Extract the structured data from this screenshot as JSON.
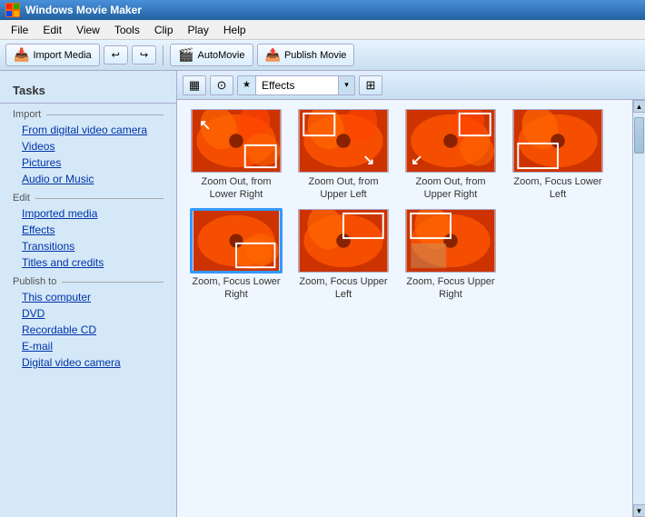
{
  "titlebar": {
    "app_name": "Windows Movie Maker",
    "icon_text": "M"
  },
  "menubar": {
    "items": [
      "File",
      "Edit",
      "View",
      "Tools",
      "Clip",
      "Play",
      "Help"
    ]
  },
  "toolbar": {
    "import_label": "Import Media",
    "automovie_label": "AutoMovie",
    "publish_label": "Publish Movie"
  },
  "sidebar": {
    "tasks_label": "Tasks",
    "import_section": "Import",
    "import_links": [
      "From digital video camera",
      "Videos",
      "Pictures",
      "Audio or Music"
    ],
    "edit_section": "Edit",
    "edit_links": [
      "Imported media",
      "Effects",
      "Transitions",
      "Titles and credits"
    ],
    "publish_section": "Publish to",
    "publish_links": [
      "This computer",
      "DVD",
      "Recordable CD",
      "E-mail",
      "Digital video camera"
    ]
  },
  "content_toolbar": {
    "view1_icon": "▦",
    "view2_icon": "●",
    "dropdown_label": "Effects",
    "dropdown_icon": "★",
    "extra_icon": "⊞"
  },
  "effects": [
    {
      "id": "e1",
      "label": "Zoom Out, from Lower Right",
      "selected": false,
      "arrow_pos": "top-left",
      "box_pos": "bottom-right"
    },
    {
      "id": "e2",
      "label": "Zoom Out, from Upper Left",
      "selected": false,
      "arrow_pos": "bottom-right",
      "box_pos": "top-left"
    },
    {
      "id": "e3",
      "label": "Zoom Out, from Upper Right",
      "selected": false,
      "arrow_pos": "bottom-left",
      "box_pos": "top-right"
    },
    {
      "id": "e4",
      "label": "Zoom, Focus Lower Left",
      "selected": false,
      "arrow_pos": "bottom-left-in",
      "box_pos": "bottom-left"
    },
    {
      "id": "e5",
      "label": "Zoom, Focus Lower Right",
      "selected": true,
      "arrow_pos": "bottom-right-in",
      "box_pos": "bottom-right"
    },
    {
      "id": "e6",
      "label": "Zoom, Focus Upper Left",
      "selected": false,
      "arrow_pos": "top-left-in",
      "box_pos": "top-left"
    },
    {
      "id": "e7",
      "label": "Zoom, Focus Upper Right",
      "selected": false,
      "arrow_pos": "top-right-in",
      "box_pos": "top-right"
    }
  ]
}
